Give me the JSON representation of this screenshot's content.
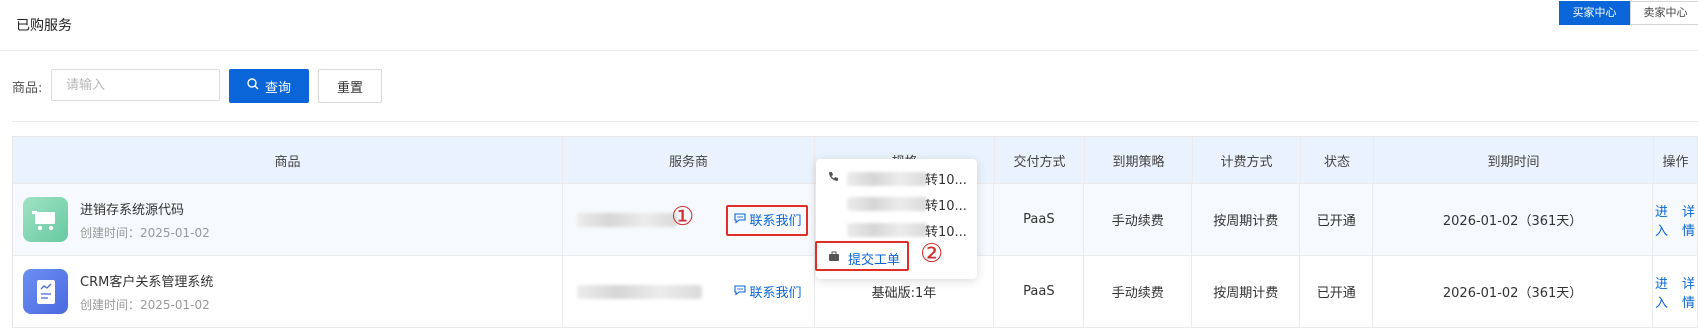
{
  "header": {
    "title": "已购服务"
  },
  "role_switch": {
    "buyer": "买家中心",
    "seller": "卖家中心"
  },
  "filter": {
    "label": "商品:",
    "placeholder": "请输入",
    "query_label": "查询",
    "reset_label": "重置"
  },
  "table": {
    "columns": [
      "商品",
      "服务商",
      "规格",
      "交付方式",
      "到期策略",
      "计费方式",
      "状态",
      "到期时间",
      "操作"
    ],
    "rows": [
      {
        "name": "进销存系统源代码",
        "created": "创建时间：2025-01-02",
        "contact": "联系我们",
        "spec": "",
        "delivery": "PaaS",
        "policy": "手动续费",
        "billing": "按周期计费",
        "status": "已开通",
        "expire": "2026-01-02（361天）",
        "actions": {
          "enter": "进入",
          "detail": "详情"
        }
      },
      {
        "name": "CRM客户关系管理系统",
        "created": "创建时间：2025-01-02",
        "contact": "联系我们",
        "spec": "基础版:1年",
        "delivery": "PaaS",
        "policy": "手动续费",
        "billing": "按周期计费",
        "status": "已开通",
        "expire": "2026-01-02（361天）",
        "actions": {
          "enter": "进入",
          "detail": "详情"
        }
      }
    ]
  },
  "popover": {
    "phones": [
      "转10...",
      "转10...",
      "转10..."
    ],
    "ticket_label": "提交工单"
  },
  "annotations": {
    "step1": "①",
    "step2": "②"
  },
  "colors": {
    "accent": "#0a66d8",
    "highlight": "#e02d25"
  },
  "icons": [
    "search-icon",
    "chat-icon",
    "phone-icon",
    "briefcase-icon",
    "cart-icon",
    "document-chart-icon"
  ]
}
